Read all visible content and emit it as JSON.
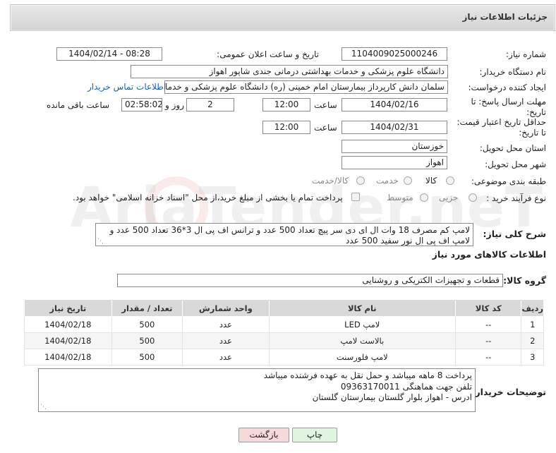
{
  "panel": {
    "title": "جزئیات اطلاعات نیاز"
  },
  "fields": {
    "need_number_label": "شماره نیاز:",
    "need_number": "1104009025000246",
    "announce_label": "تاریخ و ساعت اعلان عمومی:",
    "announce_value": "1404/02/14 - 08:28",
    "buyer_org_label": "نام دستگاه خریدار:",
    "buyer_org": "دانشگاه علوم پزشکی و خدمات بهداشتی درمانی جندی شاپور اهواز",
    "creator_label": "ایجاد کننده درخواست:",
    "creator": "سلمان دانش کارپرداز بیمارستان امام خمینی (ره) دانشگاه علوم پزشکی و خدما",
    "buyer_contact_link": "اطلاعات تماس خریدار",
    "reply_deadline_label_1": "مهلت ارسال پاسخ: تا",
    "reply_deadline_label_2": "تاریخ:",
    "reply_date": "1404/02/16",
    "time_label": "ساعت",
    "reply_time": "12:00",
    "days_value": "2",
    "days_label": "روز و",
    "remaining_time": "02:58:02",
    "remaining_label": "ساعت باقی مانده",
    "price_validity_label_1": "حداقل تاریخ اعتبار قیمت:",
    "price_validity_label_2": "تا تاریخ:",
    "price_date": "1404/02/31",
    "price_time": "12:00",
    "province_label": "استان محل تحویل:",
    "province": "خوزستان",
    "city_label": "شهر محل تحویل:",
    "city": "اهواز",
    "category_label": "طبقه بندی موضوعی:",
    "category_options": [
      "کالا",
      "خدمت",
      "کالا/خدمت"
    ],
    "process_label": "نوع فرآیند خرید :",
    "process_options": [
      "جزیی",
      "متوسط"
    ],
    "payment_note": "پرداخت تمام یا بخشی از مبلغ خرید،از محل \"اسناد خزانه اسلامی\" خواهد بود.",
    "description_label": "شرح کلی نیاز:",
    "description": "لامپ کم مصرف 18 وات ال ای دی سر پیچ تعداد 500 عدد و ترانس اف پی ال 3*36 تعداد 500 عدد و لامپ اف پی ال نور سفید 500 عدد",
    "goods_info_title": "اطلاعات کالاهای مورد نیاز",
    "goods_group_label": "گروه کالا:",
    "goods_group": "قطعات و تجهیزات الکتریکی و روشنایی",
    "buyer_notes_label": "توضیحات خریدار:",
    "buyer_notes": [
      "پرداخت 8 ماهه میباشد و حمل نقل به عهده فرشنده میباشد",
      "تلفن جهت هماهنگی 09363170011",
      "ادرس - اهواز بلوار گلستان بیمارستان گلستان"
    ]
  },
  "table": {
    "headers": [
      "ردیف",
      "کد کالا",
      "نام کالا",
      "واحد شمارش",
      "تعداد / مقدار",
      "تاریخ نیاز"
    ],
    "rows": [
      [
        "1",
        "--",
        "لامپ LED",
        "عدد",
        "500",
        "1404/02/18"
      ],
      [
        "2",
        "--",
        "بالاست لامپ",
        "عدد",
        "500",
        "1404/02/18"
      ],
      [
        "3",
        "--",
        "لامپ فلورسنت",
        "عدد",
        "500",
        "1404/02/18"
      ]
    ]
  },
  "buttons": {
    "print": "چاپ",
    "back": "بازگشت"
  },
  "watermark": {
    "text": "AriaTender.neT"
  },
  "colors": {
    "header_bg": "#dcdcdc",
    "link": "#1a5fb4",
    "back_button_bg": "#f6d9d9",
    "print_button_bg": "#dff5df"
  }
}
